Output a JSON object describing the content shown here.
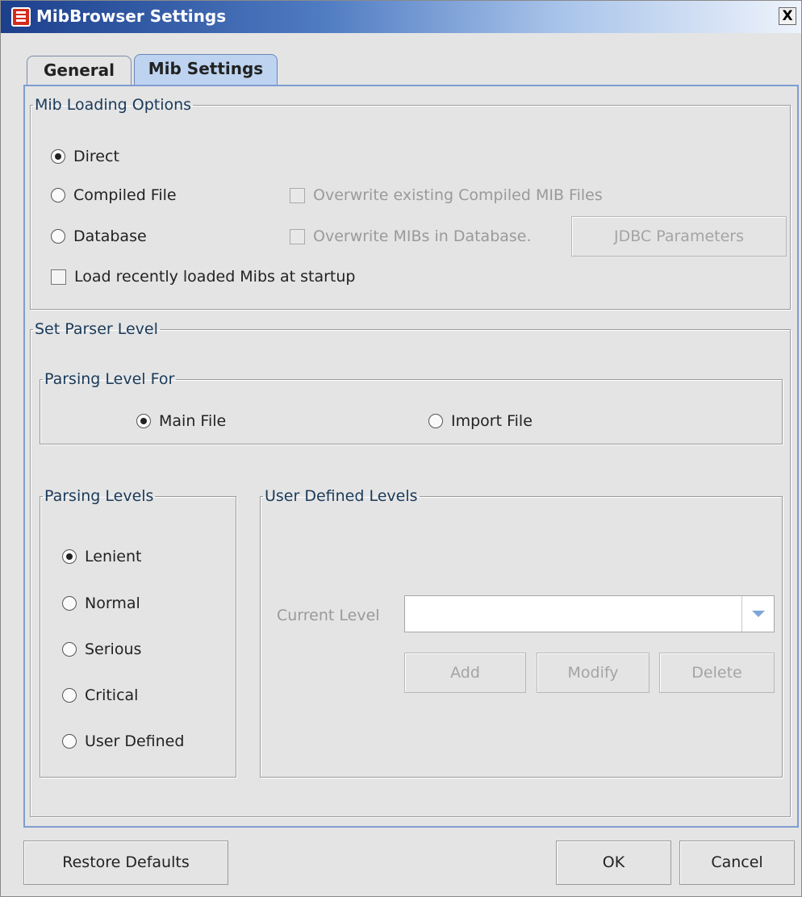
{
  "window": {
    "title": "MibBrowser Settings",
    "close_label": "X"
  },
  "tabs": [
    {
      "label": "General",
      "selected": false
    },
    {
      "label": "Mib Settings",
      "selected": true
    }
  ],
  "mib_loading": {
    "legend": "Mib Loading Options",
    "direct": {
      "label": "Direct",
      "checked": true
    },
    "compiled": {
      "label": "Compiled File",
      "checked": false
    },
    "database": {
      "label": "Database",
      "checked": false
    },
    "overwrite_compiled": {
      "label": "Overwrite existing Compiled MIB Files",
      "checked": false,
      "enabled": false
    },
    "overwrite_db": {
      "label": "Overwrite MIBs in Database.",
      "checked": false,
      "enabled": false
    },
    "jdbc_button": "JDBC Parameters",
    "load_recent": {
      "label": "Load recently loaded Mibs at startup",
      "checked": false
    }
  },
  "parser": {
    "legend": "Set Parser Level",
    "for_legend": "Parsing Level For",
    "main_file": {
      "label": "Main File",
      "checked": true
    },
    "import_file": {
      "label": "Import File",
      "checked": false
    },
    "levels_legend": "Parsing Levels",
    "levels": [
      {
        "label": "Lenient",
        "checked": true
      },
      {
        "label": "Normal",
        "checked": false
      },
      {
        "label": "Serious",
        "checked": false
      },
      {
        "label": "Critical",
        "checked": false
      },
      {
        "label": "User Defined",
        "checked": false
      }
    ],
    "user_legend": "User Defined Levels",
    "current_level_label": "Current Level",
    "current_level_value": "",
    "add_button": "Add",
    "modify_button": "Modify",
    "delete_button": "Delete"
  },
  "footer": {
    "restore_button": "Restore Defaults",
    "ok_button": "OK",
    "cancel_button": "Cancel"
  },
  "colors": {
    "titlebar_start": "#1c3f8c",
    "tab_selected": "#bdd3f0",
    "panel_border": "#7f9dd2",
    "background": "#e4e4e4"
  }
}
